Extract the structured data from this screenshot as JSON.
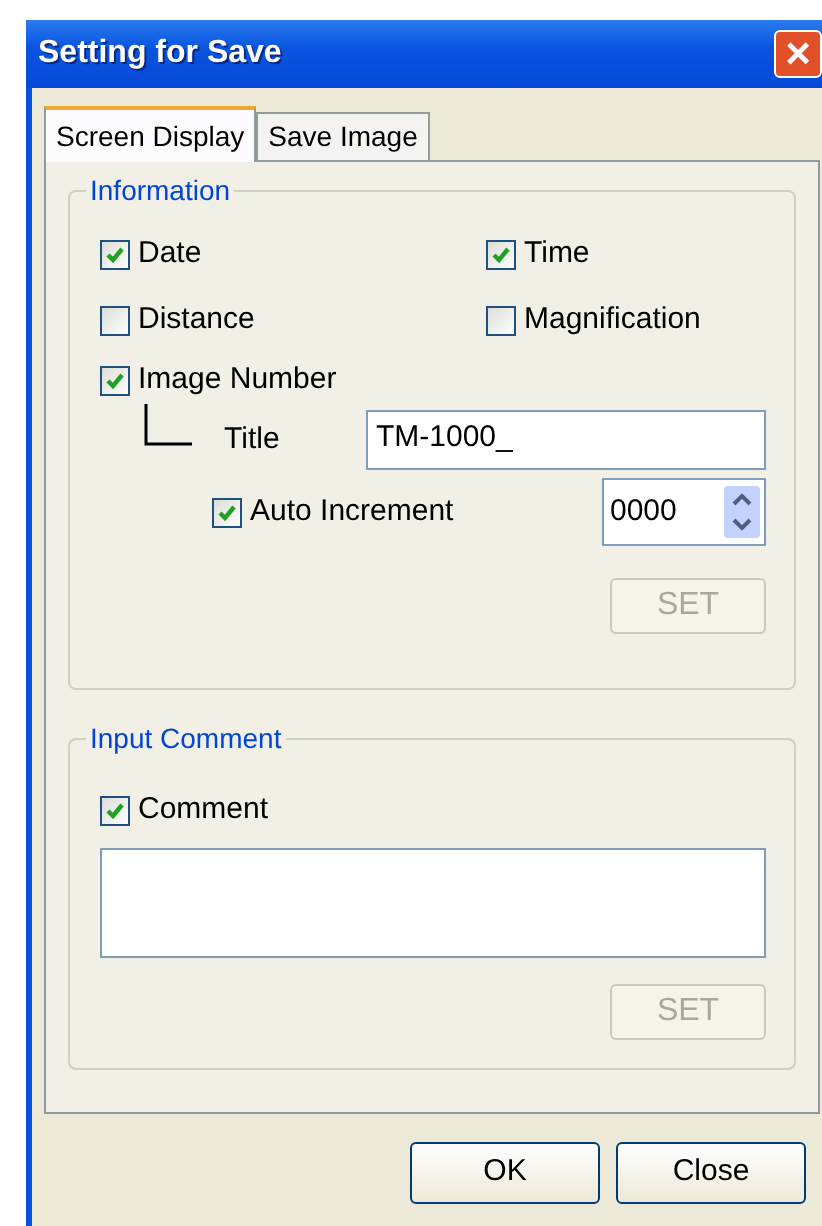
{
  "window": {
    "title": "Setting for Save",
    "close": "×"
  },
  "tabs": [
    {
      "label": "Screen Display",
      "selected": true
    },
    {
      "label": "Save Image",
      "selected": false
    }
  ],
  "information": {
    "title": "Information",
    "options": [
      {
        "label": "Date",
        "checked": true
      },
      {
        "label": "Time",
        "checked": true
      },
      {
        "label": "Distance",
        "checked": false
      },
      {
        "label": "Magnification",
        "checked": false
      }
    ],
    "image_number": {
      "label": "Image Number",
      "checked": true
    },
    "title_field": {
      "label": "Title",
      "value": "TM-1000_"
    },
    "auto_increment": {
      "label": "Auto Increment",
      "checked": true,
      "value": "0000"
    },
    "set_button": {
      "label": "SET",
      "disabled": true
    }
  },
  "input_comment": {
    "title": "Input Comment",
    "comment": {
      "label": "Comment",
      "checked": true
    },
    "set_button": {
      "label": "SET",
      "disabled": true
    }
  },
  "buttons": [
    {
      "label": "OK"
    },
    {
      "label": "Close"
    }
  ]
}
